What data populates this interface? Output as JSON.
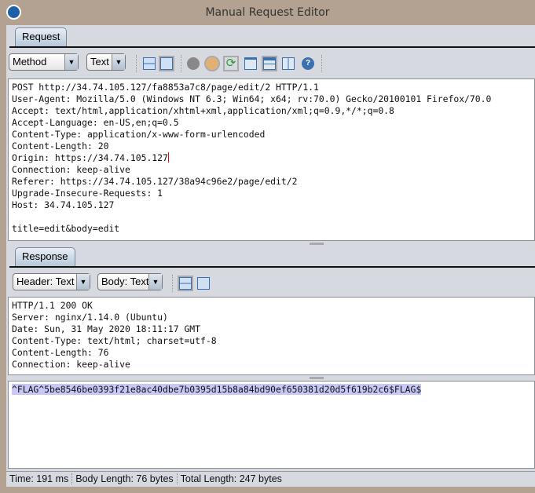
{
  "window": {
    "title": "Manual Request Editor"
  },
  "request": {
    "tab": "Request",
    "method_combo": "Method",
    "view_combo": "Text",
    "lines": [
      "POST http://34.74.105.127/fa8853a7c8/page/edit/2 HTTP/1.1",
      "User-Agent: Mozilla/5.0 (Windows NT 6.3; Win64; x64; rv:70.0) Gecko/20100101 Firefox/70.0",
      "Accept: text/html,application/xhtml+xml,application/xml;q=0.9,*/*;q=0.8",
      "Accept-Language: en-US,en;q=0.5",
      "Content-Type: application/x-www-form-urlencoded",
      "Content-Length: 20",
      "Origin: https://34.74.105.127",
      "Connection: keep-alive",
      "Referer: https://34.74.105.127/38a94c96e2/page/edit/2",
      "Upgrade-Insecure-Requests: 1",
      "Host: 34.74.105.127",
      "",
      "title=edit&body=edit"
    ]
  },
  "response": {
    "tab": "Response",
    "header_combo": "Header: Text",
    "body_combo": "Body: Text",
    "header_lines": [
      "HTTP/1.1 200 OK",
      "Server: nginx/1.14.0 (Ubuntu)",
      "Date: Sun, 31 May 2020 18:11:17 GMT",
      "Content-Type: text/html; charset=utf-8",
      "Content-Length: 76",
      "Connection: keep-alive"
    ],
    "body": "^FLAG^5be8546be0393f21e8ac40dbe7b0395d15b8a84bd90ef650381d20d5f619b2c6$FLAG$"
  },
  "status": {
    "time": "Time: 191 ms",
    "body_length": "Body Length: 76 bytes",
    "total_length": "Total Length: 247 bytes"
  },
  "colors": {
    "selection": "#c8c8f8",
    "title_bar": "#b3a291",
    "panel": "#d6d9df"
  }
}
